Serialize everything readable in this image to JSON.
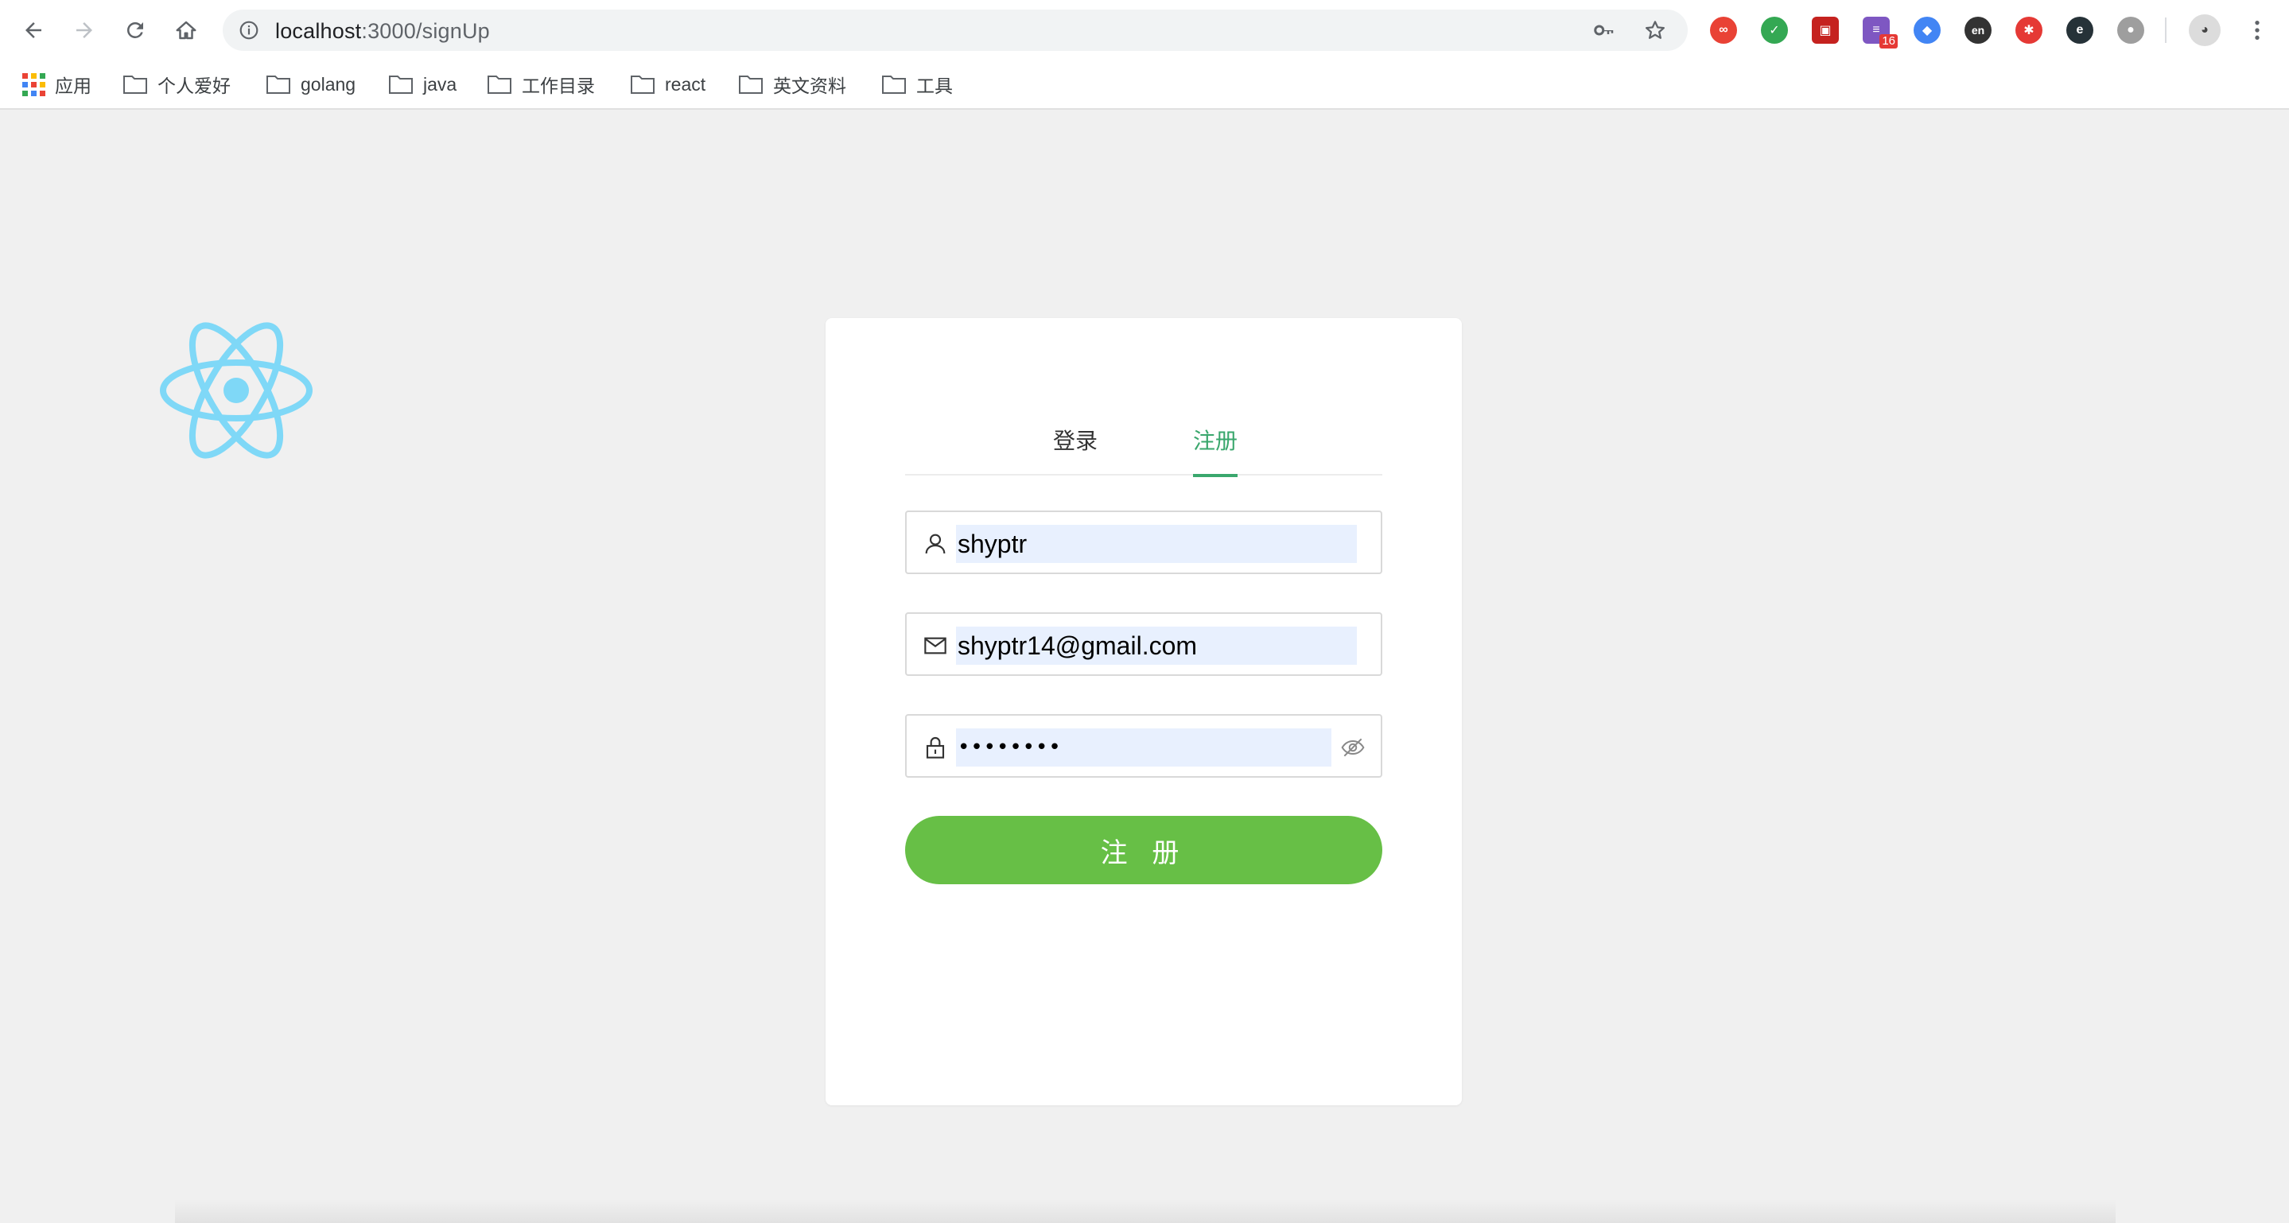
{
  "browser": {
    "url_host": "localhost",
    "url_path": ":3000/signUp",
    "extensions": [
      {
        "name": "infinity-extension-icon",
        "color": "#e94235",
        "glyph": "∞"
      },
      {
        "name": "shield-extension-icon",
        "color": "#34a853",
        "glyph": "✓"
      },
      {
        "name": "picture-extension-icon",
        "color": "#c5221f",
        "glyph": "▣"
      },
      {
        "name": "chat-extension-icon",
        "color": "#7e57c2",
        "glyph": "≡",
        "badge": "16"
      },
      {
        "name": "graduation-cap-extension-icon",
        "color": "#4285f4",
        "glyph": "◆"
      },
      {
        "name": "translate-extension-icon",
        "color": "#333333",
        "glyph": "en"
      },
      {
        "name": "asterisk-extension-icon",
        "color": "#e53935",
        "glyph": "✱"
      },
      {
        "name": "e-extension-icon",
        "color": "#263238",
        "glyph": "e"
      },
      {
        "name": "circle-extension-icon",
        "color": "#9e9e9e",
        "glyph": "●"
      },
      {
        "name": "profile-avatar-icon",
        "color": "#dcdcdc",
        "glyph": "◕"
      }
    ]
  },
  "bookmarks": {
    "apps": "应用",
    "items": [
      "个人爱好",
      "golang",
      "java",
      "工作目录",
      "react",
      "英文资料",
      "工具"
    ]
  },
  "colors": {
    "accent": "#3aa76d",
    "button": "#67bf46",
    "autofill": "#e8f0fe",
    "react_logo": "#7fd8f7"
  },
  "form": {
    "tabs": {
      "login": "登录",
      "signup": "注册",
      "active": "signup"
    },
    "username": "shyptr",
    "email": "shyptr14@gmail.com",
    "password": "••••••••",
    "submit": "注 册"
  }
}
